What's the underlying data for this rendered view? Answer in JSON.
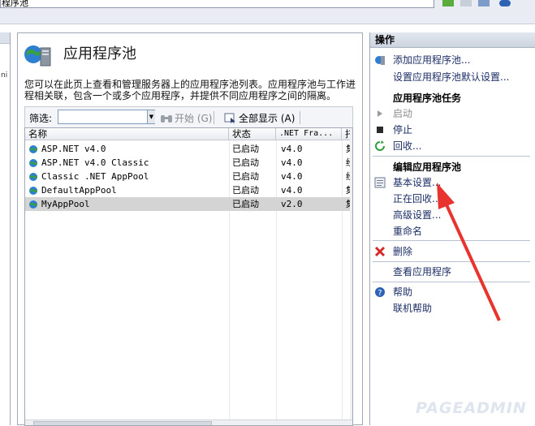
{
  "topbar": {
    "address_fragment": "程序池"
  },
  "tree": {
    "fragment": "ni"
  },
  "center": {
    "title": "应用程序池",
    "description": "您可以在此页上查看和管理服务器上的应用程序池列表。应用程序池与工作进程相关联，包含一个或多个应用程序，并提供不同应用程序之间的隔离。",
    "filter": {
      "label": "筛选:",
      "value": "",
      "start_label": "开始 (G)",
      "show_all_label": "全部显示 (A)"
    },
    "columns": [
      "名称",
      "状态",
      ".NET Fra...",
      "托"
    ],
    "rows": [
      {
        "name": "ASP.NET v4.0",
        "status": "已启动",
        "net": "v4.0",
        "mode": "集",
        "selected": false
      },
      {
        "name": "ASP.NET v4.0 Classic",
        "status": "已启动",
        "net": "v4.0",
        "mode": "经",
        "selected": false
      },
      {
        "name": "Classic .NET AppPool",
        "status": "已启动",
        "net": "v4.0",
        "mode": "经",
        "selected": false
      },
      {
        "name": "DefaultAppPool",
        "status": "已启动",
        "net": "v4.0",
        "mode": "集",
        "selected": false
      },
      {
        "name": "MyAppPool",
        "status": "已启动",
        "net": "v2.0",
        "mode": "集",
        "selected": true
      }
    ]
  },
  "actions": {
    "header": "操作",
    "items": {
      "add_pool": "添加应用程序池...",
      "set_defaults": "设置应用程序池默认设置...",
      "tasks_header": "应用程序池任务",
      "start": "启动",
      "stop": "停止",
      "recycle": "回收...",
      "edit_header": "编辑应用程序池",
      "basic_settings": "基本设置...",
      "recycling": "正在回收...",
      "advanced": "高级设置...",
      "rename": "重命名",
      "delete": "删除",
      "view_apps": "查看应用程序",
      "help": "帮助",
      "online_help": "联机帮助"
    }
  },
  "watermark": "PAGEADMIN",
  "colors": {
    "arrow": "#e8332f",
    "link": "#1c2f66",
    "selected_row": "#d4d4d4"
  }
}
